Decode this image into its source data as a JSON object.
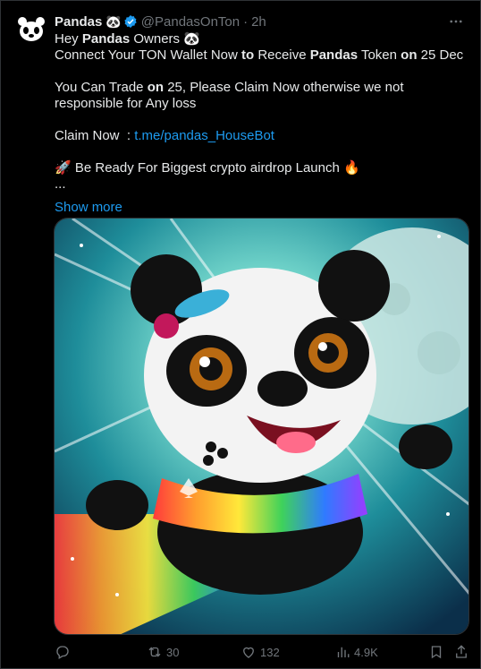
{
  "author": {
    "name": "Pandas",
    "emoji": "🐼",
    "handle": "@PandasOnTon",
    "separator": "·",
    "time": "2h",
    "avatar_icon": "panda-logo-icon"
  },
  "tweet": {
    "line1_pre": "Hey ",
    "line1_bold": "Pandas",
    "line1_post": " Owners 🐼",
    "line2_a": "Connect Your TON Wallet Now ",
    "line2_b": "to",
    "line2_c": " Receive ",
    "line2_d": "Pandas",
    "line2_e": " Token ",
    "line2_f": "on",
    "line2_g": " 25 Dec",
    "para2_a": "You Can Trade ",
    "para2_b": "on",
    "para2_c": " 25, Please Claim Now otherwise we not responsible for Any loss",
    "claim_label": "Claim Now  : ",
    "claim_link": "t.me/pandas_HouseBot",
    "launch_text": "🚀 Be Ready For Biggest crypto airdrop Launch 🔥",
    "ellipsis": "...",
    "show_more": "Show more"
  },
  "media": {
    "alt": "Cartoon panda flying on a rainbow in front of a full moon",
    "icon": "panda-image"
  },
  "actions": {
    "reply_count": "",
    "retweet_count": "30",
    "like_count": "132",
    "views_count": "4.9K"
  },
  "colors": {
    "accent": "#1d9bf0",
    "muted": "#71767b",
    "text": "#e7e9ea",
    "bg": "#000000"
  }
}
